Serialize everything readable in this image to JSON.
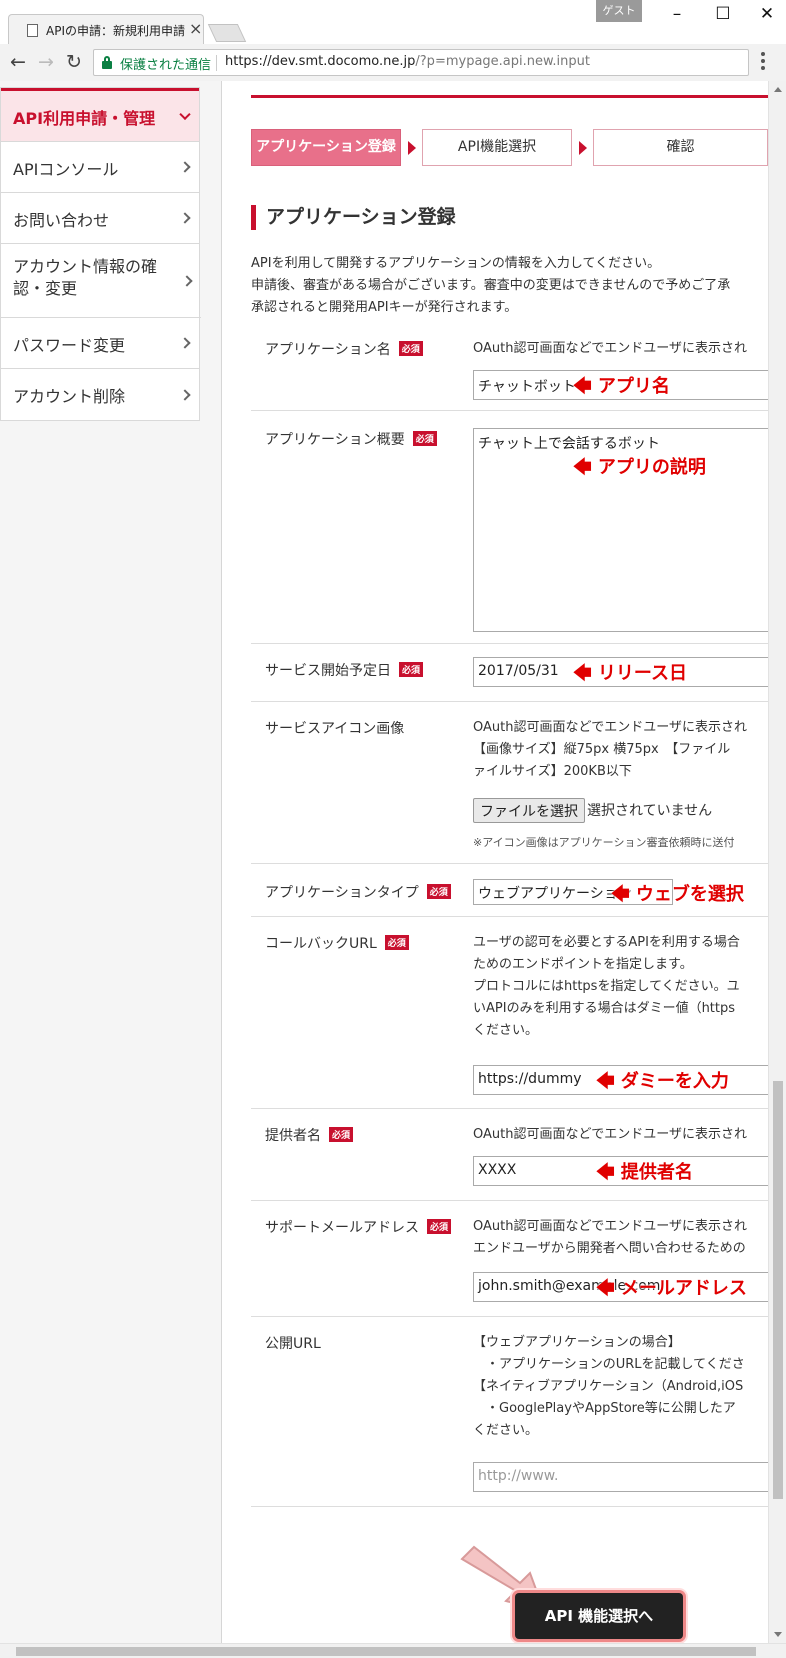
{
  "browser": {
    "tab_title": "APIの申請：新規利用申請",
    "guest_label": "ゲスト",
    "secure_label": "保護された通信",
    "url_main": "https://dev.smt.docomo.ne.jp",
    "url_rest": "/?p=mypage.api.new.input"
  },
  "sidebar": {
    "items": [
      {
        "label": "API利用申請・管理"
      },
      {
        "label": "APIコンソール"
      },
      {
        "label": "お問い合わせ"
      },
      {
        "label": "アカウント情報の確認・変更"
      },
      {
        "label": "パスワード変更"
      },
      {
        "label": "アカウント削除"
      }
    ]
  },
  "steps": [
    "アプリケーション登録",
    "API機能選択",
    "確認"
  ],
  "section_title": "アプリケーション登録",
  "intro": [
    "APIを利用して開発するアプリケーションの情報を入力してください。",
    "申請後、審査がある場合がございます。審査中の変更はできませんので予めご了承",
    "承認されると開発用APIキーが発行されます。"
  ],
  "required_badge": "必須",
  "form": {
    "app_name": {
      "label": "アプリケーション名",
      "desc": "OAuth認可画面などでエンドユーザに表示され",
      "value": "チャットボット",
      "annotation": "アプリ名"
    },
    "app_summary": {
      "label": "アプリケーション概要",
      "value": "チャット上で会話するボット",
      "annotation": "アプリの説明"
    },
    "start_date": {
      "label": "サービス開始予定日",
      "value": "2017/05/31",
      "annotation": "リリース日"
    },
    "icon_image": {
      "label": "サービスアイコン画像",
      "desc": [
        "OAuth認可画面などでエンドユーザに表示され",
        "【画像サイズ】縦75px 横75px　【ファイル",
        "ァイルサイズ】200KB以下"
      ],
      "button": "ファイルを選択",
      "status": "選択されていません",
      "note": "※アイコン画像はアプリケーション審査依頼時に送付"
    },
    "app_type": {
      "label": "アプリケーションタイプ",
      "value": "ウェブアプリケーション",
      "annotation": "ウェブを選択"
    },
    "callback": {
      "label": "コールバックURL",
      "desc": [
        "ユーザの認可を必要とするAPIを利用する場合",
        "ためのエンドポイントを指定します。",
        "プロトコルにはhttpsを指定してください。ユ",
        "いAPIのみを利用する場合はダミー値（https",
        "ください。"
      ],
      "value": "https://dummy",
      "annotation": "ダミーを入力"
    },
    "provider": {
      "label": "提供者名",
      "desc": "OAuth認可画面などでエンドユーザに表示され",
      "value": "XXXX",
      "annotation": "提供者名"
    },
    "support_email": {
      "label": "サポートメールアドレス",
      "desc": [
        "OAuth認可画面などでエンドユーザに表示され",
        "エンドユーザから開発者へ問い合わせるための"
      ],
      "value": "john.smith@example.com",
      "annotation": "メールアドレス"
    },
    "public_url": {
      "label": "公開URL",
      "desc": [
        "【ウェブアプリケーションの場合】",
        "　・アプリケーションのURLを記載してくださ",
        "【ネイティブアプリケーション（Android,iOS",
        "　・GooglePlayやAppStore等に公開したア",
        "ください。"
      ],
      "placeholder": "http://www."
    }
  },
  "next_button": "API 機能選択へ",
  "colors": {
    "brand": "#c8102e",
    "annotation": "#e00000"
  }
}
